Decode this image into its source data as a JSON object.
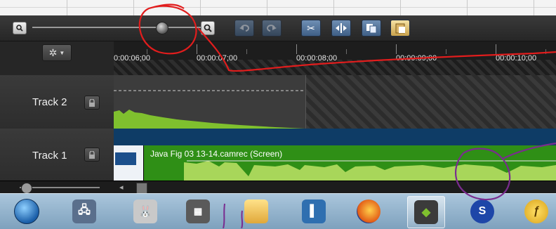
{
  "toolbar": {
    "icons": [
      "zoom-out-icon",
      "zoom-in-icon",
      "undo-icon",
      "redo-icon",
      "cut-icon",
      "split-icon",
      "copy-icon",
      "paste-icon"
    ],
    "zoom_level": 0.78
  },
  "ruler": {
    "labels": [
      "0:00:06;00",
      "00:00:07;00",
      "00:00:08;00",
      "00:00:09;00",
      "00:00:10;00"
    ]
  },
  "tracks": [
    {
      "name": "Track 2"
    },
    {
      "name": "Track 1",
      "clip_label": "Java Fig 03 13-14.camrec (Screen)"
    }
  ],
  "taskbar": {
    "items": [
      "start-orb-icon",
      "network-icon",
      "calculator-bunny-icon",
      "calculator-icon",
      "file-explorer-icon",
      "contacts-book-icon",
      "firefox-icon",
      "camtasia-icon",
      "sync-s-icon",
      "flash-icon"
    ],
    "active_index": 7
  },
  "colors": {
    "clip_green": "#2f8f16",
    "audio_green": "#7fc02e",
    "annotation_red": "#e11d1d",
    "annotation_purple": "#7a2c8f",
    "band_blue": "#0e3c66"
  }
}
